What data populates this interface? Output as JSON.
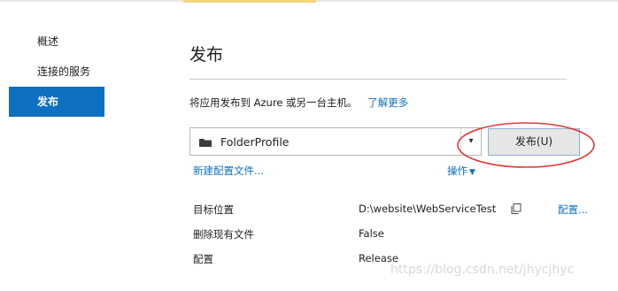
{
  "sidebar": {
    "items": [
      {
        "label": "概述"
      },
      {
        "label": "连接的服务"
      },
      {
        "label": "发布"
      }
    ]
  },
  "main": {
    "title": "发布",
    "description": "将应用发布到 Azure 或另一台主机。",
    "learn_more": "了解更多",
    "profile": {
      "name": "FolderProfile",
      "dropdown_icon": "chevron-down-icon"
    },
    "publish_button": "发布(U)",
    "new_profile_link": "新建配置文件...",
    "actions_link": "操作",
    "properties": [
      {
        "label": "目标位置",
        "value": "D:\\website\\WebServiceTest",
        "action": "配置..."
      },
      {
        "label": "删除现有文件",
        "value": "False"
      },
      {
        "label": "配置",
        "value": "Release"
      }
    ]
  },
  "watermark": "https://blog.csdn.net/jhycjhyc",
  "colors": {
    "accent": "#0e70c0",
    "annotation": "#e03a3a"
  }
}
